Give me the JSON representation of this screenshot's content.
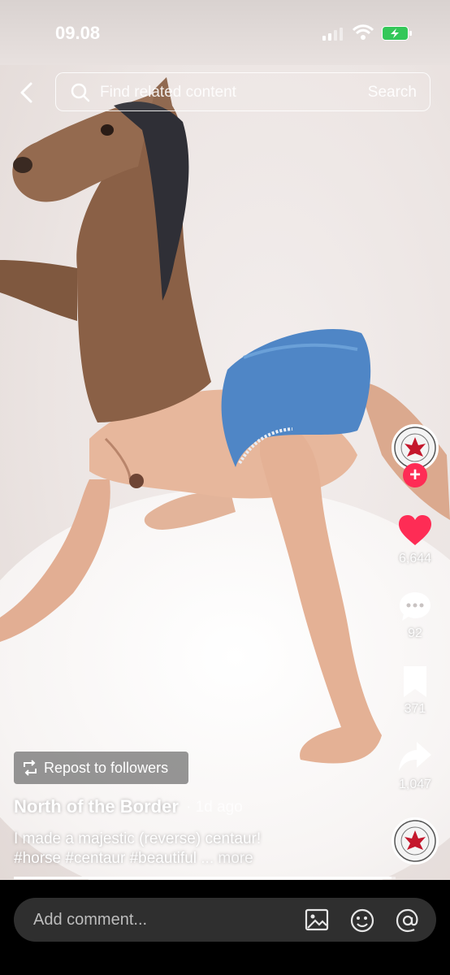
{
  "status_bar": {
    "time": "09.08"
  },
  "search": {
    "placeholder": "Find related content",
    "button_label": "Search"
  },
  "rail": {
    "like_count": "6,644",
    "comment_count": "92",
    "save_count": "371",
    "share_count": "1,047",
    "follow_symbol": "+",
    "like_color": "#fe2c55"
  },
  "post": {
    "repost_label": "Repost to followers",
    "author": "North of the Border",
    "time_ago": "· 1d ago",
    "caption_line1": "I made a majestic (reverse) centaur!",
    "caption_line2": "#horse #centaur #beautiful",
    "more_label": "... more",
    "progress": 0.99
  },
  "comment_bar": {
    "placeholder": "Add comment..."
  },
  "icons": [
    "back-icon",
    "search-icon",
    "heart-icon",
    "comment-icon",
    "bookmark-icon",
    "share-icon",
    "repost-icon",
    "image-icon",
    "emoji-icon",
    "mention-icon"
  ]
}
